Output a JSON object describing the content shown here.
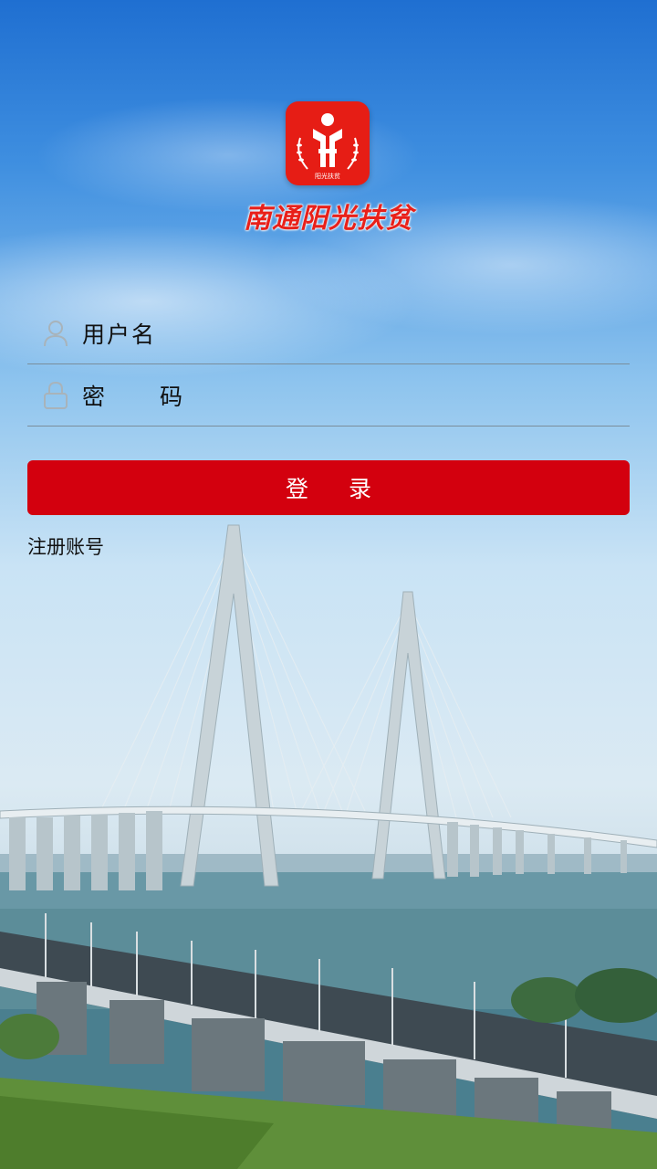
{
  "app": {
    "name": "南通阳光扶贫",
    "logo_badge_text": "阳光扶贫",
    "brand_color": "#e61d15"
  },
  "login_form": {
    "username": {
      "placeholder": "用户名",
      "icon": "user-icon"
    },
    "password": {
      "placeholder": "密 码",
      "icon": "lock-icon"
    },
    "submit_label": "登 录",
    "submit_color": "#d3000e",
    "register_link": "注册账号"
  },
  "background": {
    "scene": "cable-stayed-bridge-over-river",
    "sky_color": "#1f6fd1"
  }
}
